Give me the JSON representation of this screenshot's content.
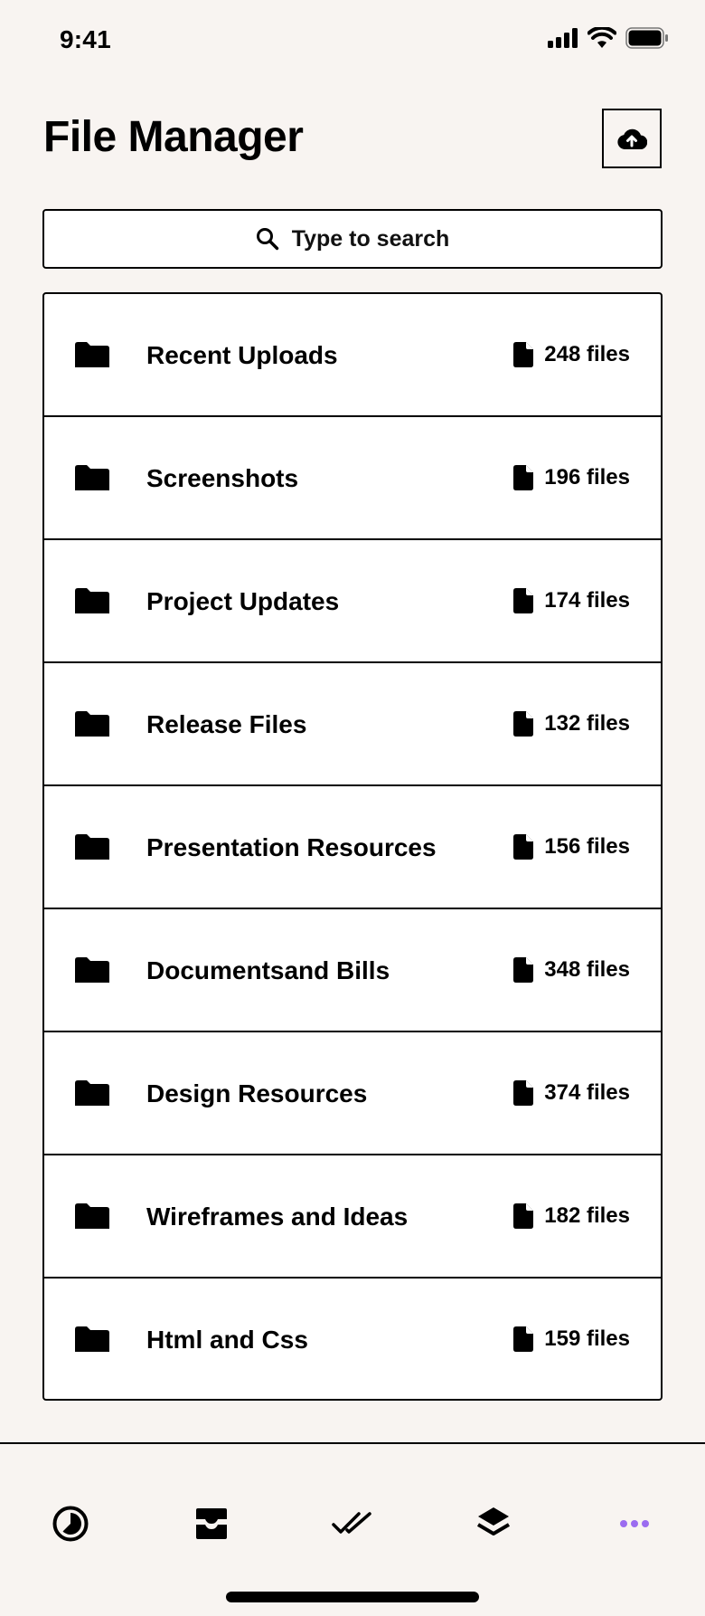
{
  "status_bar": {
    "time": "9:41",
    "icons": [
      "signal-icon",
      "wifi-icon",
      "battery-icon"
    ]
  },
  "header": {
    "title": "File Manager",
    "upload_icon": "cloud-upload-icon"
  },
  "search": {
    "placeholder": "Type to search",
    "icon": "search-icon"
  },
  "folders": [
    {
      "name": "Recent Uploads",
      "count": "248 files"
    },
    {
      "name": "Screenshots",
      "count": "196 files"
    },
    {
      "name": "Project Updates",
      "count": "174 files"
    },
    {
      "name": "Release Files",
      "count": "132 files"
    },
    {
      "name": "Presentation Resources",
      "count": "156 files"
    },
    {
      "name": "Documentsand Bills",
      "count": "348 files"
    },
    {
      "name": "Design Resources",
      "count": "374 files"
    },
    {
      "name": "Wireframes and Ideas",
      "count": "182 files"
    },
    {
      "name": "Html and Css",
      "count": "159 files"
    }
  ],
  "bottom_nav": {
    "items": [
      "timer-icon",
      "inbox-icon",
      "double-check-icon",
      "layers-icon",
      "more-icon"
    ],
    "active_color": "#9b6cf0"
  }
}
